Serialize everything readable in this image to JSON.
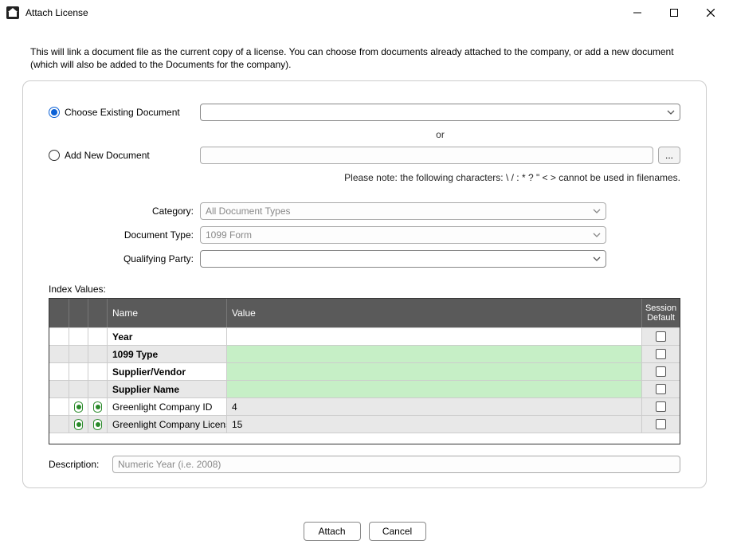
{
  "window": {
    "title": "Attach License"
  },
  "intro": "This will link a document file as the current copy of a license.  You can choose from documents already attached to the company, or add a new document (which will also be added to the Documents for the  company).",
  "radios": {
    "existing_label": "Choose Existing Document",
    "addnew_label": "Add New Document",
    "selected": "existing"
  },
  "existing_combo_value": "",
  "addnew_text_value": "",
  "or_label": "or",
  "browse_label": "...",
  "filename_note": "Please note:  the following characters:  \\ / : * ? \" < > cannot be used in filenames.",
  "category": {
    "label": "Category:",
    "value": "All Document Types"
  },
  "doctype": {
    "label": "Document Type:",
    "value": "1099 Form"
  },
  "qualparty": {
    "label": "Qualifying Party:",
    "value": ""
  },
  "index": {
    "label": "Index Values:",
    "columns": {
      "name": "Name",
      "value": "Value",
      "session": "Session Default"
    },
    "rows": [
      {
        "name": "Year",
        "value": "",
        "name_bold": true,
        "name_bg": "white",
        "value_bg": "white",
        "icons": false
      },
      {
        "name": "1099 Type",
        "value": "",
        "name_bold": true,
        "name_bg": "gray",
        "value_bg": "green",
        "icons": false
      },
      {
        "name": "Supplier/Vendor",
        "value": "",
        "name_bold": true,
        "name_bg": "white",
        "value_bg": "green",
        "icons": false
      },
      {
        "name": "Supplier Name",
        "value": "",
        "name_bold": true,
        "name_bg": "gray",
        "value_bg": "green",
        "icons": false
      },
      {
        "name": "Greenlight Company ID",
        "value": "4",
        "name_bold": false,
        "name_bg": "white",
        "value_bg": "gray",
        "icons": true
      },
      {
        "name": "Greenlight Company Licens...",
        "value": "15",
        "name_bold": false,
        "name_bg": "gray",
        "value_bg": "gray",
        "icons": true
      }
    ]
  },
  "description": {
    "label": "Description:",
    "placeholder": "Numeric Year (i.e. 2008)"
  },
  "buttons": {
    "attach": "Attach",
    "cancel": "Cancel"
  }
}
